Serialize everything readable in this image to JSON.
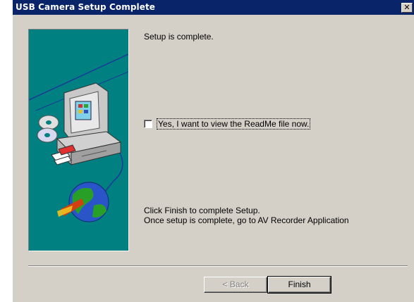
{
  "window": {
    "title": "USB Camera Setup Complete",
    "close_glyph": "✕"
  },
  "main": {
    "heading": "Setup is complete.",
    "readme_checkbox": {
      "label": "Yes, I want to view the ReadMe file now.",
      "checked": false
    },
    "instructions": [
      "Click Finish to complete Setup.",
      "Once setup is complete, go to AV Recorder Application"
    ]
  },
  "buttons": {
    "back_label": "< Back",
    "finish_label": "Finish"
  },
  "side_panel": {
    "background_color": "#008080",
    "icons": [
      "computer-icon",
      "cd-icon",
      "floppy-icon",
      "globe-icon"
    ]
  },
  "colors": {
    "title_bar": "#0a246a",
    "dialog_face": "#d4d0c8"
  }
}
